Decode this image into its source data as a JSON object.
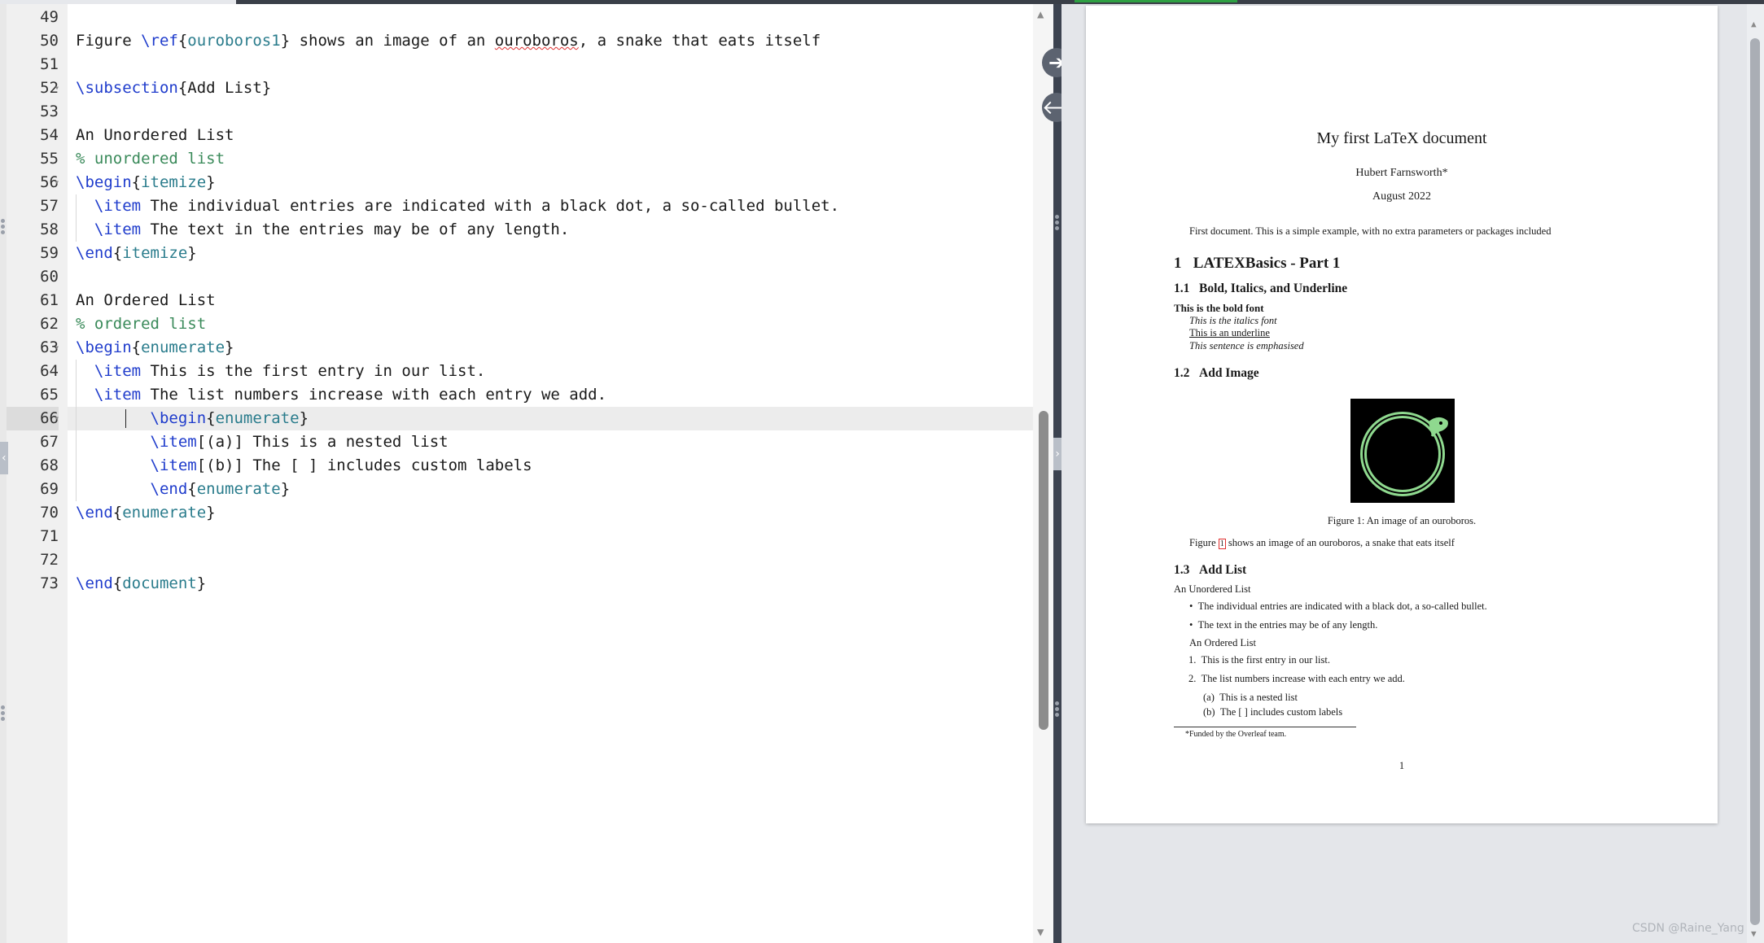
{
  "editor": {
    "lines": [
      {
        "num": "49",
        "tokens": []
      },
      {
        "num": "50",
        "tokens": [
          {
            "t": "Figure ",
            "c": ""
          },
          {
            "t": "\\ref",
            "c": "kw"
          },
          {
            "t": "{",
            "c": ""
          },
          {
            "t": "ouroboros1",
            "c": "arg"
          },
          {
            "t": "} shows an image of an ",
            "c": ""
          },
          {
            "t": "ouroboros",
            "c": "spell"
          },
          {
            "t": ", a snake that eats itself",
            "c": ""
          }
        ]
      },
      {
        "num": "51",
        "tokens": []
      },
      {
        "num": "52",
        "fold": true,
        "tokens": [
          {
            "t": "\\subsection",
            "c": "kw"
          },
          {
            "t": "{Add List}",
            "c": ""
          }
        ]
      },
      {
        "num": "53",
        "tokens": []
      },
      {
        "num": "54",
        "tokens": [
          {
            "t": "An Unordered List",
            "c": ""
          }
        ]
      },
      {
        "num": "55",
        "tokens": [
          {
            "t": "% unordered list",
            "c": "cmt"
          }
        ]
      },
      {
        "num": "56",
        "fold": true,
        "tokens": [
          {
            "t": "\\begin",
            "c": "kw"
          },
          {
            "t": "{",
            "c": ""
          },
          {
            "t": "itemize",
            "c": "arg"
          },
          {
            "t": "}",
            "c": ""
          }
        ]
      },
      {
        "num": "57",
        "tokens": [
          {
            "t": "  ",
            "c": ""
          },
          {
            "t": "\\item",
            "c": "kw"
          },
          {
            "t": " The individual entries are indicated with a black dot, a so-called bullet.",
            "c": ""
          }
        ]
      },
      {
        "num": "58",
        "tokens": [
          {
            "t": "  ",
            "c": ""
          },
          {
            "t": "\\item",
            "c": "kw"
          },
          {
            "t": " The text in the entries may be of any length.",
            "c": ""
          }
        ]
      },
      {
        "num": "59",
        "tokens": [
          {
            "t": "\\end",
            "c": "kw"
          },
          {
            "t": "{",
            "c": ""
          },
          {
            "t": "itemize",
            "c": "arg"
          },
          {
            "t": "}",
            "c": ""
          }
        ]
      },
      {
        "num": "60",
        "tokens": []
      },
      {
        "num": "61",
        "tokens": [
          {
            "t": "An Ordered List",
            "c": ""
          }
        ]
      },
      {
        "num": "62",
        "tokens": [
          {
            "t": "% ordered list",
            "c": "cmt"
          }
        ]
      },
      {
        "num": "63",
        "fold": true,
        "tokens": [
          {
            "t": "\\begin",
            "c": "kw"
          },
          {
            "t": "{",
            "c": ""
          },
          {
            "t": "enumerate",
            "c": "arg"
          },
          {
            "t": "}",
            "c": ""
          }
        ]
      },
      {
        "num": "64",
        "tokens": [
          {
            "t": "  ",
            "c": ""
          },
          {
            "t": "\\item",
            "c": "kw"
          },
          {
            "t": " This is the first entry in our list.",
            "c": ""
          }
        ]
      },
      {
        "num": "65",
        "tokens": [
          {
            "t": "  ",
            "c": ""
          },
          {
            "t": "\\item",
            "c": "kw"
          },
          {
            "t": " The list numbers increase with each entry we add.",
            "c": ""
          }
        ]
      },
      {
        "num": "66",
        "fold": true,
        "active": true,
        "tokens": [
          {
            "t": "        ",
            "c": ""
          },
          {
            "t": "\\begin",
            "c": "kw"
          },
          {
            "t": "{",
            "c": ""
          },
          {
            "t": "enumerate",
            "c": "arg"
          },
          {
            "t": "}",
            "c": ""
          }
        ]
      },
      {
        "num": "67",
        "tokens": [
          {
            "t": "        ",
            "c": ""
          },
          {
            "t": "\\item",
            "c": "kw"
          },
          {
            "t": "[(a)] This is a nested list",
            "c": ""
          }
        ]
      },
      {
        "num": "68",
        "tokens": [
          {
            "t": "        ",
            "c": ""
          },
          {
            "t": "\\item",
            "c": "kw"
          },
          {
            "t": "[(b)] The [ ] includes custom labels",
            "c": ""
          }
        ]
      },
      {
        "num": "69",
        "tokens": [
          {
            "t": "        ",
            "c": ""
          },
          {
            "t": "\\end",
            "c": "kw"
          },
          {
            "t": "{",
            "c": ""
          },
          {
            "t": "enumerate",
            "c": "arg"
          },
          {
            "t": "}",
            "c": ""
          }
        ]
      },
      {
        "num": "70",
        "tokens": [
          {
            "t": "\\end",
            "c": "kw"
          },
          {
            "t": "{",
            "c": ""
          },
          {
            "t": "enumerate",
            "c": "arg"
          },
          {
            "t": "}",
            "c": ""
          }
        ]
      },
      {
        "num": "71",
        "tokens": []
      },
      {
        "num": "72",
        "tokens": []
      },
      {
        "num": "73",
        "tokens": [
          {
            "t": "\\end",
            "c": "kw"
          },
          {
            "t": "{",
            "c": ""
          },
          {
            "t": "document",
            "c": "arg"
          },
          {
            "t": "}",
            "c": ""
          }
        ]
      }
    ]
  },
  "divider": {
    "to_pdf_icon": "arrow-right-icon",
    "to_source_icon": "arrow-left-icon"
  },
  "pdf": {
    "title": "My first LaTeX document",
    "author": "Hubert Farnsworth*",
    "date": "August 2022",
    "abstract": "First document. This is a simple example, with no extra parameters or packages included",
    "sec1": {
      "num": "1",
      "title": "LATEXBasics - Part 1"
    },
    "sec11": {
      "num": "1.1",
      "title": "Bold, Italics, and Underline"
    },
    "bold_line": "This is the bold font",
    "italic_line": "This is the italics font",
    "underline_line": "This is an underline",
    "emph_line": "This sentence is emphasised",
    "sec12": {
      "num": "1.2",
      "title": "Add Image"
    },
    "figure_caption": "Figure 1: An image of an ouroboros.",
    "figure_ref_pre": "Figure ",
    "figure_ref_link": "1",
    "figure_ref_post": " shows an image of an ouroboros, a snake that eats itself",
    "sec13": {
      "num": "1.3",
      "title": "Add List"
    },
    "unordered_heading": "An Unordered List",
    "bullets": [
      "The individual entries are indicated with a black dot, a so-called bullet.",
      "The text in the entries may be of any length."
    ],
    "ordered_heading": "An Ordered List",
    "ordered": [
      {
        "n": "1.",
        "text": "This is the first entry in our list."
      },
      {
        "n": "2.",
        "text": "The list numbers increase with each entry we add."
      }
    ],
    "nested": [
      {
        "n": "(a)",
        "text": "This is a nested list"
      },
      {
        "n": "(b)",
        "text": "The [ ] includes custom labels"
      }
    ],
    "footnote": "*Funded by the Overleaf team.",
    "page_number": "1"
  },
  "watermark": "CSDN @Raine_Yang"
}
